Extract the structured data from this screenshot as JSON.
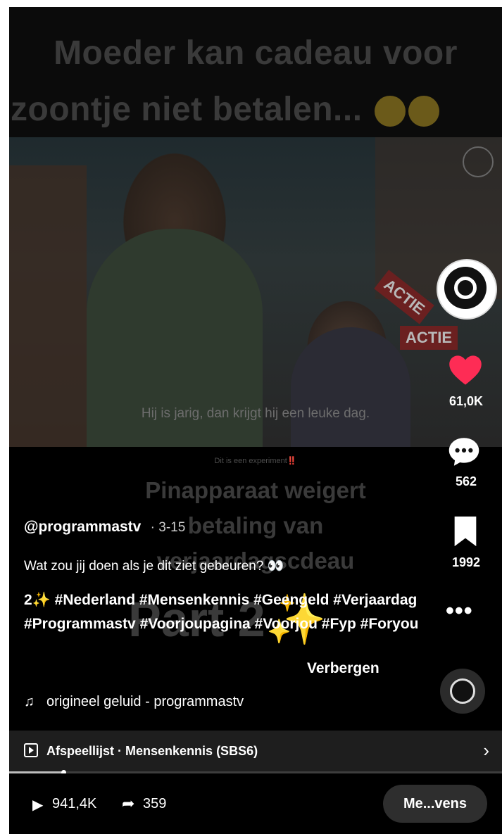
{
  "video": {
    "title_line1": "Moeder kan cadeau voor",
    "title_line2": "zoontje niet betalen...",
    "subtitle": "Hij is jarig, dan krijgt hij een leuke dag.",
    "store_sign": "ACTIE",
    "experiment_note": "Dit is een experiment‼️",
    "overlay_line1": "Pinapparaat weigert",
    "overlay_line2": "betaling van",
    "overlay_line3": "verjaardagscdeau",
    "overlay_part": "Part 2✨"
  },
  "actions": {
    "likes": "61,0K",
    "comments": "562",
    "saves": "1992",
    "like_color": "#fe2c55"
  },
  "post": {
    "username": "@programmastv",
    "upload_date": "3-15",
    "description": "Wat zou jij doen als je dit ziet gebeuren? 👀",
    "hashtags": "2✨ #Nederland #Mensenkennis #Geengeld #Verjaardag #Programmastv #Voorjoupagina #Voorjou #Fyp #Foryou",
    "hide_label": "Verbergen",
    "sound": "origineel geluid - programmastv"
  },
  "playlist": {
    "label": "Afspeellijst · Mensenkennis (SBS6)",
    "progress": 0.11
  },
  "stats": {
    "views": "941,4K",
    "shares": "359",
    "more_label": "Me...vens"
  },
  "icons": [
    "heart-icon",
    "comment-icon",
    "bookmark-icon",
    "more-icon",
    "music-note-icon",
    "playlist-icon",
    "chevron-right-icon",
    "play-icon",
    "share-icon"
  ]
}
